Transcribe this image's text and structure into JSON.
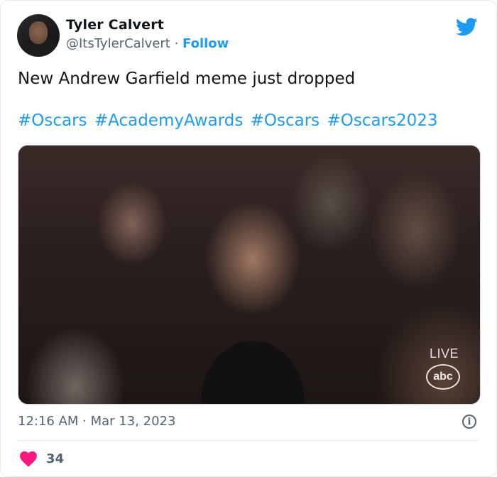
{
  "author": {
    "name": "Tyler Calvert",
    "handle": "@ItsTylerCalvert",
    "separator": " · ",
    "follow_label": "Follow"
  },
  "tweet": {
    "text": "New Andrew Garfield meme just dropped",
    "hashtags": [
      "#Oscars",
      "#AcademyAwards",
      "#Oscars",
      "#Oscars2023"
    ]
  },
  "media": {
    "live_label": "LIVE",
    "network_logo": "abc"
  },
  "meta": {
    "time": "12:16 AM",
    "separator": " · ",
    "date": "Mar 13, 2023"
  },
  "engagement": {
    "likes": "34"
  },
  "colors": {
    "link": "#1d9bf0",
    "heart": "#f91880",
    "muted": "#536471"
  },
  "icons": {
    "brand": "twitter-bird-icon",
    "like": "heart-icon",
    "info": "info-icon"
  }
}
